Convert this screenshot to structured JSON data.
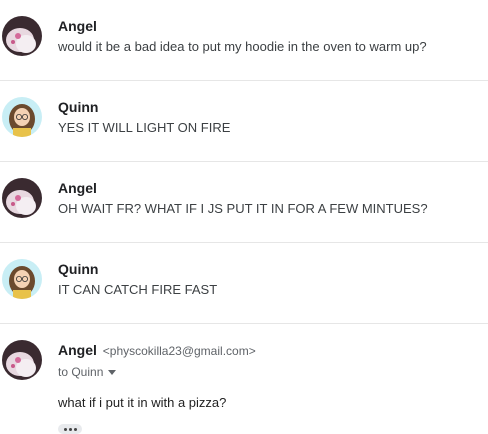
{
  "messages": [
    {
      "sender": "Angel",
      "snippet": "would it be a bad idea to put my hoodie in the oven to warm up?",
      "avatar": "angel-avatar-icon"
    },
    {
      "sender": "Quinn",
      "snippet": "YES IT WILL LIGHT ON FIRE",
      "avatar": "quinn-avatar-icon"
    },
    {
      "sender": "Angel",
      "snippet": "OH WAIT FR? WHAT IF I JS PUT IT IN FOR A FEW MINTUES?",
      "avatar": "angel-avatar-icon"
    },
    {
      "sender": "Quinn",
      "snippet": "IT CAN CATCH FIRE FAST",
      "avatar": "quinn-avatar-icon"
    }
  ],
  "expanded_message": {
    "sender": "Angel",
    "email": "<physcokilla23@gmail.com>",
    "to": "to Quinn",
    "body": "what if i put it in with a pizza?",
    "avatar": "angel-avatar-icon",
    "more_icon": "ellipsis-icon"
  },
  "colors": {
    "divider": "#e6e6e6",
    "sender": "#202124",
    "secondary": "#5f6368"
  }
}
